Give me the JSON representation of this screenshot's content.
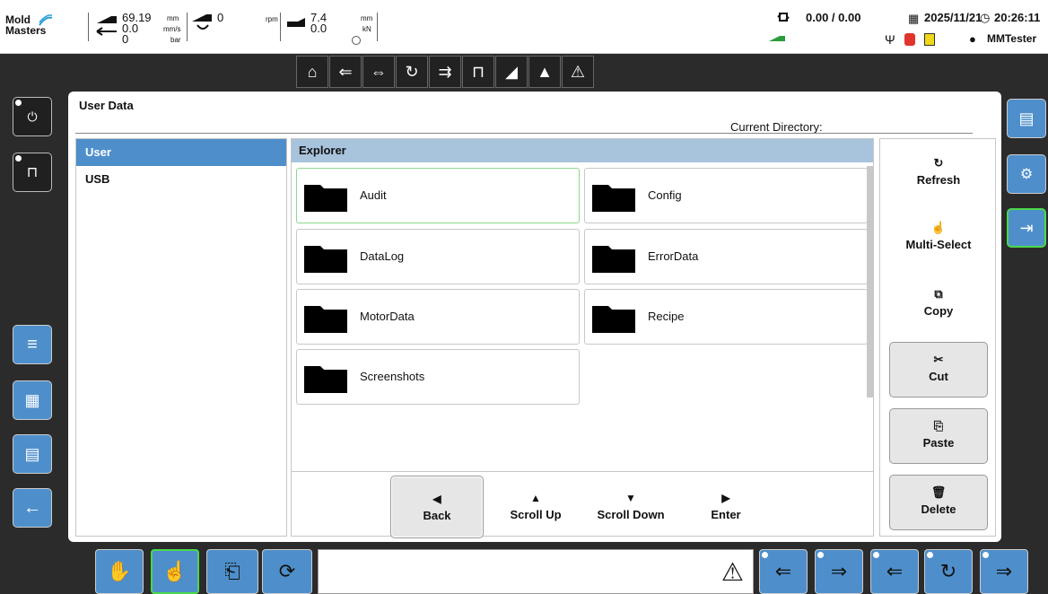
{
  "logo": {
    "line1": "Mold",
    "line2": "Masters"
  },
  "status": {
    "pos_value": "69.19",
    "pos_unit": "mm",
    "speed_value": "0.0",
    "speed_unit": "mm/s",
    "pressure_value": "0",
    "pressure_unit": "bar",
    "rpm_value": "0",
    "rpm_unit": "rpm",
    "force_value1": "7.4",
    "force_value2": "0.0",
    "force_unit1": "mm",
    "force_unit2": "kN",
    "counter": "0.00 / 0.00",
    "date": "2025/11/21",
    "time": "20:26:11",
    "user": "MMTester"
  },
  "panel": {
    "title": "User Data",
    "current_directory_label": "Current Directory:"
  },
  "locations": [
    {
      "label": "User",
      "selected": true
    },
    {
      "label": "USB",
      "selected": false
    }
  ],
  "explorer": {
    "header": "Explorer",
    "folders": [
      "Audit",
      "Config",
      "DataLog",
      "ErrorData",
      "MotorData",
      "Recipe",
      "Screenshots"
    ],
    "nav": [
      {
        "glyph": "◀",
        "label": "Back"
      },
      {
        "glyph": "▲",
        "label": "Scroll Up"
      },
      {
        "glyph": "▼",
        "label": "Scroll Down"
      },
      {
        "glyph": "▶",
        "label": "Enter"
      }
    ]
  },
  "actions": [
    {
      "glyph": "↻",
      "label": "Refresh"
    },
    {
      "glyph": "☝",
      "label": "Multi-Select"
    },
    {
      "glyph": "⧉",
      "label": "Copy"
    },
    {
      "glyph": "✂",
      "label": "Cut"
    },
    {
      "glyph": "⎘",
      "label": "Paste"
    },
    {
      "glyph": "🗑",
      "label": "Delete"
    }
  ],
  "colors": {
    "accent": "#4e8fcb",
    "active_border": "#4cd84c",
    "explorer_header": "#a8c3dc"
  }
}
